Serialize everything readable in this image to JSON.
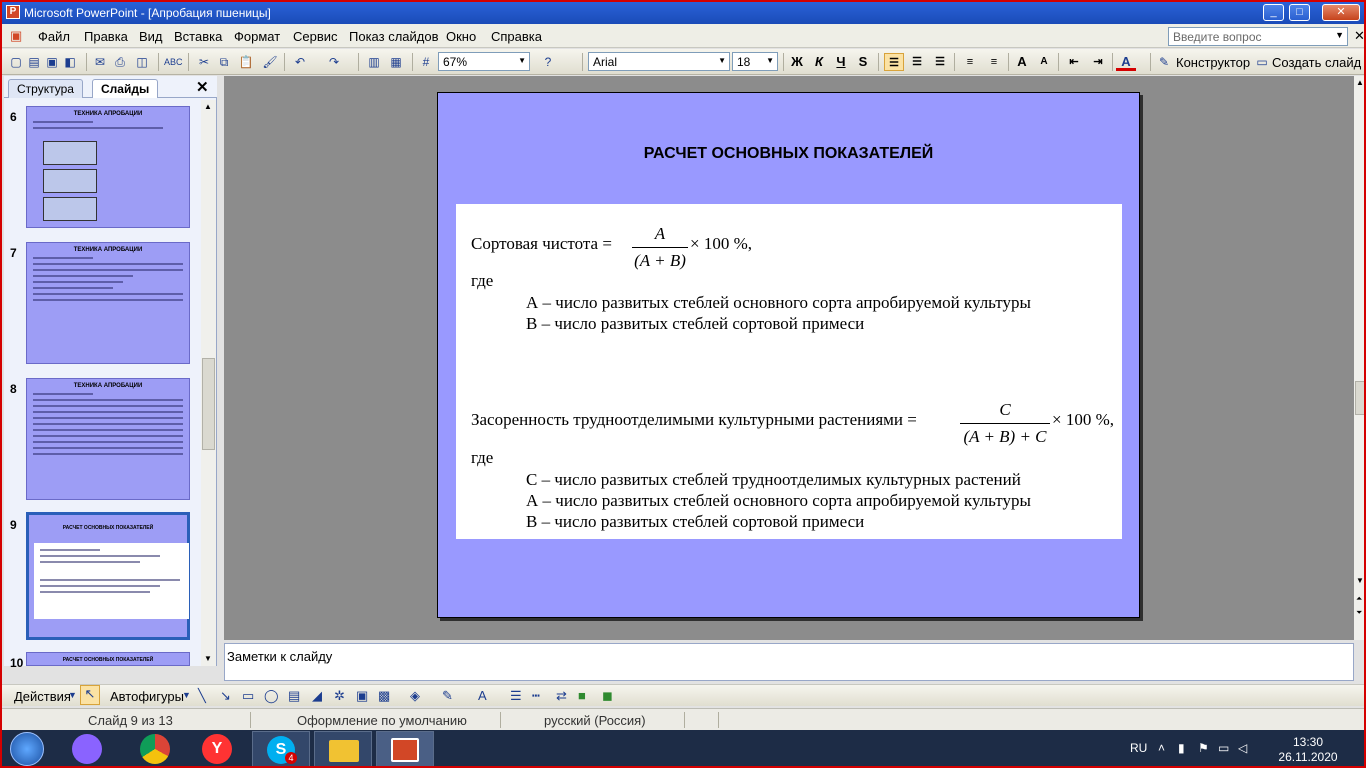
{
  "window": {
    "title": "Microsoft PowerPoint - [Апробация пшеницы]"
  },
  "menu": [
    {
      "label": "Файл"
    },
    {
      "label": "Правка"
    },
    {
      "label": "Вид"
    },
    {
      "label": "Вставка"
    },
    {
      "label": "Формат"
    },
    {
      "label": "Сервис"
    },
    {
      "label": "Показ слайдов"
    },
    {
      "label": "Окно"
    },
    {
      "label": "Справка"
    }
  ],
  "search": {
    "placeholder": "Введите вопрос"
  },
  "toolbar": {
    "zoom": "67%",
    "font": "Arial",
    "font_size": "18",
    "bold": "Ж",
    "italic": "К",
    "underline": "Ч",
    "shadow": "S",
    "designer": "Конструктор",
    "new_slide": "Создать слайд"
  },
  "left_panel": {
    "tabs": [
      {
        "label": "Структура"
      },
      {
        "label": "Слайды"
      }
    ],
    "thumbnails": [
      {
        "number": "6",
        "title": "ТЕХНИКА АПРОБАЦИИ"
      },
      {
        "number": "7",
        "title": "ТЕХНИКА АПРОБАЦИИ"
      },
      {
        "number": "8",
        "title": "ТЕХНИКА АПРОБАЦИИ"
      },
      {
        "number": "9",
        "title": "РАСЧЕТ ОСНОВНЫХ ПОКАЗАТЕЛЕЙ"
      },
      {
        "number": "10",
        "title": "РАСЧЕТ ОСНОВНЫХ ПОКАЗАТЕЛЕЙ"
      }
    ]
  },
  "slide": {
    "title": "РАСЧЕТ ОСНОВНЫХ ПОКАЗАТЕЛЕЙ",
    "formula1": {
      "lhs": "Сортовая чистота =",
      "numerator": "A",
      "denominator": "(A + B)",
      "suffix": "× 100 %,",
      "where": "где",
      "defs": [
        "А – число развитых стеблей основного сорта апробируемой культуры",
        "В – число развитых стеблей сортовой примеси"
      ]
    },
    "formula2": {
      "lhs": "Засоренность трудноотделимыми культурными растениями =",
      "numerator": "C",
      "denominator": "(A + B) + C",
      "suffix": "× 100 %,",
      "where": "где",
      "defs": [
        "С – число развитых стеблей трудноотделимых культурных растений",
        "А – число развитых стеблей основного сорта апробируемой культуры",
        "В – число развитых стеблей сортовой примеси"
      ]
    }
  },
  "notes": {
    "placeholder": "Заметки к слайду"
  },
  "drawing": {
    "actions": "Действия",
    "autoshapes": "Автофигуры"
  },
  "status": {
    "slide": "Слайд 9 из 13",
    "design": "Оформление по умолчанию",
    "language": "русский (Россия)"
  },
  "taskbar": {
    "lang": "RU",
    "time": "13:30",
    "date": "26.11.2020",
    "skype_badge": "4"
  }
}
